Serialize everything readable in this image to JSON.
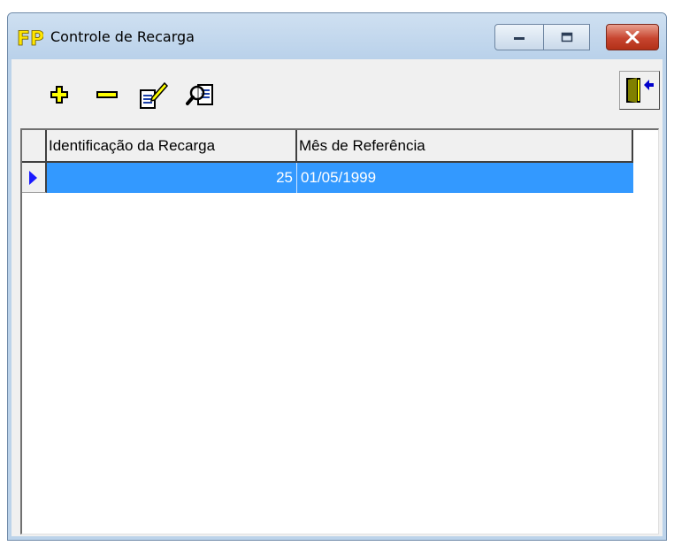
{
  "window": {
    "title": "Controle de Recarga",
    "app_icon": "fp-app-icon"
  },
  "titlebar_buttons": [
    {
      "name": "minimize",
      "icon": "minimize-icon"
    },
    {
      "name": "maximize",
      "icon": "maximize-icon"
    },
    {
      "name": "close",
      "icon": "close-icon"
    }
  ],
  "toolbar": {
    "buttons": [
      {
        "name": "add",
        "icon": "plus-icon",
        "color": "#ffff00"
      },
      {
        "name": "remove",
        "icon": "minus-icon",
        "color": "#ffff00"
      },
      {
        "name": "edit",
        "icon": "edit-document-icon"
      },
      {
        "name": "search",
        "icon": "search-document-icon"
      }
    ],
    "exit": {
      "icon": "exit-door-icon"
    }
  },
  "grid": {
    "columns": [
      "Identificação da Recarga",
      "Mês de Referência"
    ],
    "rows": [
      {
        "id": "25",
        "month": "01/05/1999",
        "selected": true
      }
    ],
    "selection_color": "#3399ff"
  }
}
